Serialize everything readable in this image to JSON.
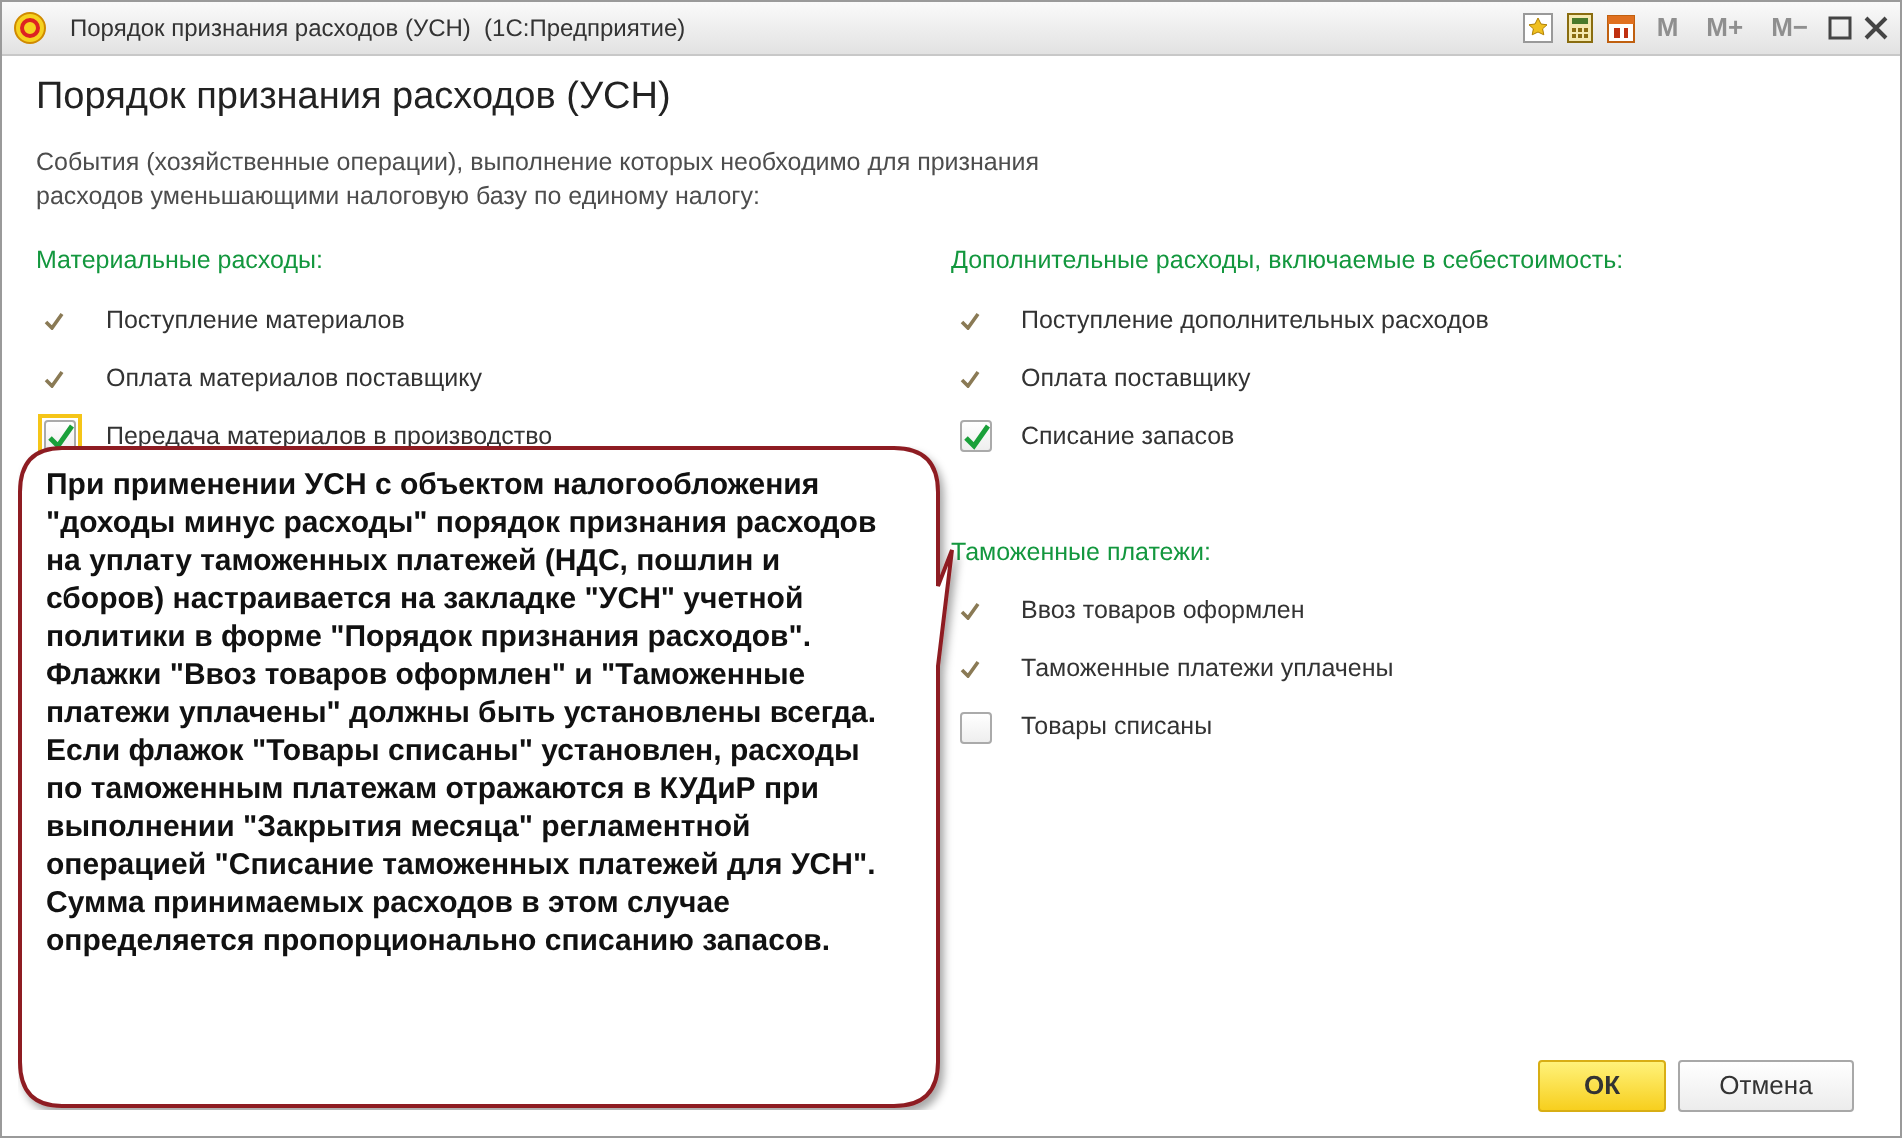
{
  "window": {
    "title": "Порядок признания расходов (УСН)  (1С:Предприятие)",
    "memory_buttons": [
      {
        "label": "M",
        "disabled": true
      },
      {
        "label": "M+",
        "disabled": true
      },
      {
        "label": "M−",
        "disabled": true
      }
    ]
  },
  "heading": "Порядок признания расходов (УСН)",
  "description": "События (хозяйственные операции), выполнение которых необходимо для признания расходов уменьшающими налоговую базу по единому налогу:",
  "left_sections": [
    {
      "title": "Материальные расходы:",
      "items": [
        {
          "kind": "tick",
          "label": "Поступление материалов"
        },
        {
          "kind": "tick",
          "label": "Оплата материалов поставщику"
        },
        {
          "kind": "checkbox",
          "label": "Передача материалов в производство",
          "checked": true,
          "focused": true
        }
      ]
    }
  ],
  "right_sections": [
    {
      "title": "Дополнительные расходы, включаемые в себестоимость:",
      "items": [
        {
          "kind": "tick",
          "label": "Поступление дополнительных расходов"
        },
        {
          "kind": "tick",
          "label": "Оплата поставщику"
        },
        {
          "kind": "checkbox",
          "label": "Списание запасов",
          "checked": true,
          "focused": false
        }
      ]
    },
    {
      "title": "Таможенные платежи:",
      "items": [
        {
          "kind": "tick",
          "label": "Ввоз товаров оформлен"
        },
        {
          "kind": "tick",
          "label": "Таможенные платежи уплачены"
        },
        {
          "kind": "checkbox",
          "label": "Товары списаны",
          "checked": false,
          "focused": false
        }
      ]
    }
  ],
  "callout": {
    "paragraphs": [
      "При применении УСН с объектом налогообложения \"доходы минус расходы\" порядок признания расходов на уплату таможенных платежей (НДС, пошлин и сборов) настраивается на закладке \"УСН\" учетной политики в форме \"Порядок признания расходов\".",
      "Флажки \"Ввоз товаров оформлен\" и \"Таможенные платежи уплачены\" должны быть установлены всегда.",
      "Если флажок \"Товары списаны\" установлен, расходы по таможенным платежам отражаются в КУДиР при выполнении \"Закрытия месяца\" регламентной операцией \"Списание таможенных платежей для УСН\". Сумма принимаемых расходов в этом случае определяется пропорционально списанию запасов."
    ]
  },
  "buttons": [
    {
      "label": "ОК",
      "kind": "primary"
    },
    {
      "label": "Отмена",
      "kind": "secondary"
    }
  ]
}
